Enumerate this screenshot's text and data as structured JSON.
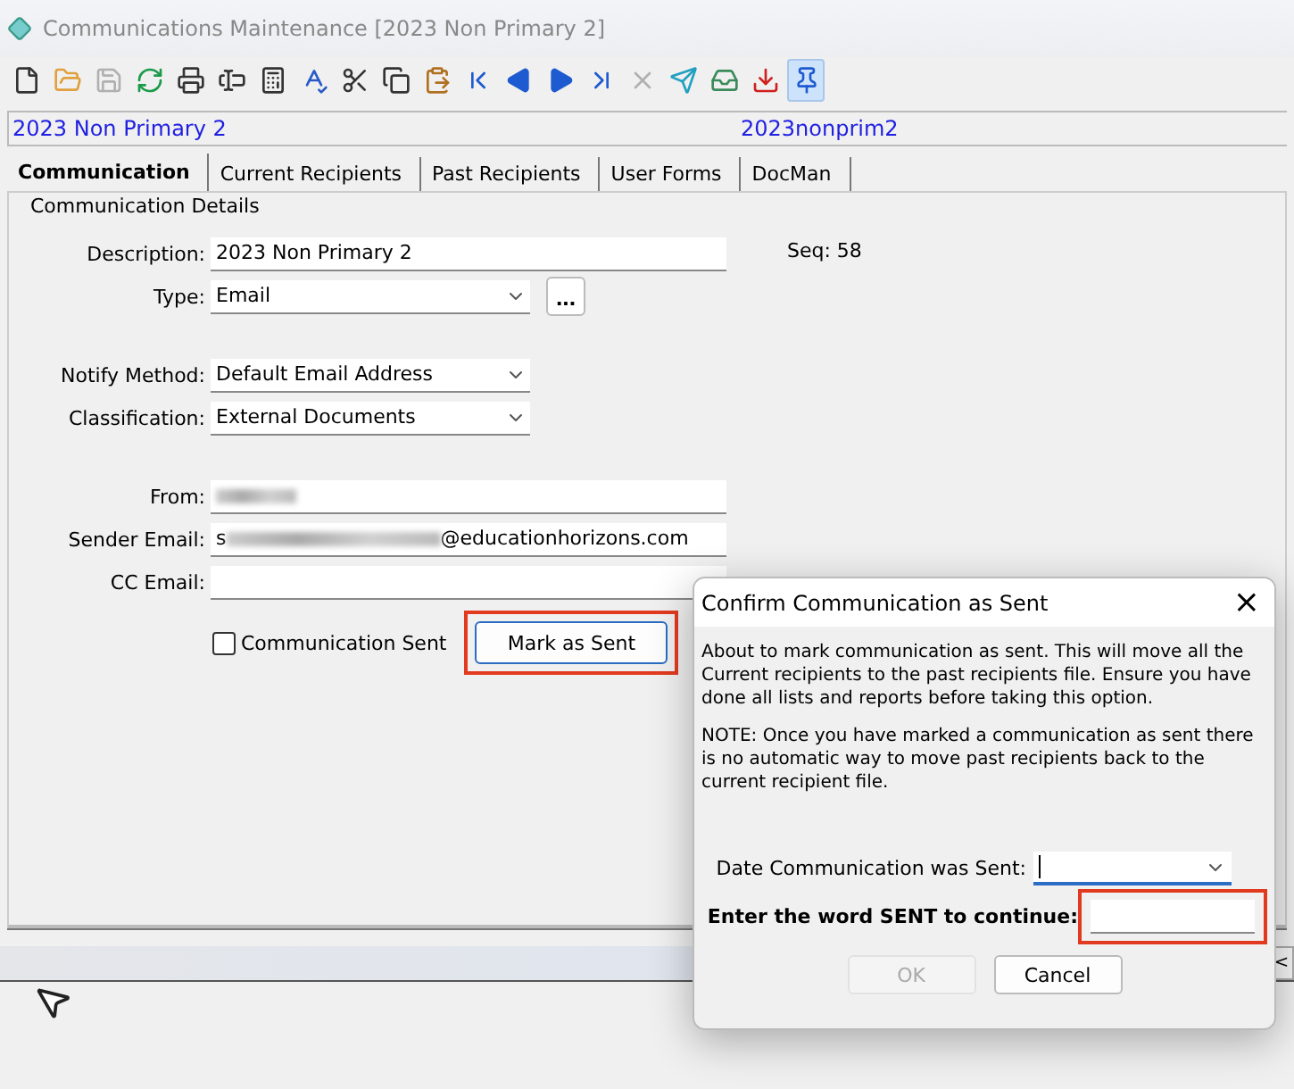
{
  "window": {
    "title": "Communications Maintenance  [2023 Non Primary 2]"
  },
  "toolbar": [
    {
      "disabled": false,
      "pressed": false
    },
    {
      "disabled": false,
      "pressed": false
    },
    {
      "disabled": true,
      "pressed": false
    },
    {
      "disabled": false,
      "pressed": false
    },
    {
      "disabled": false,
      "pressed": false
    },
    {
      "disabled": false,
      "pressed": false
    },
    {
      "disabled": false,
      "pressed": false
    },
    {
      "disabled": false,
      "pressed": false
    },
    {
      "disabled": false,
      "pressed": false
    },
    {
      "disabled": false,
      "pressed": false
    },
    {
      "disabled": false,
      "pressed": false
    },
    {
      "disabled": false,
      "pressed": false
    },
    {
      "disabled": false,
      "pressed": false
    },
    {
      "disabled": false,
      "pressed": false
    },
    {
      "disabled": false,
      "pressed": false
    },
    {
      "disabled": true,
      "pressed": false
    },
    {
      "disabled": false,
      "pressed": false
    },
    {
      "disabled": false,
      "pressed": false
    },
    {
      "disabled": false,
      "pressed": false
    },
    {
      "disabled": false,
      "pressed": true
    }
  ],
  "header": {
    "name": "2023 Non Primary 2",
    "code": "2023nonprim2"
  },
  "tabs": [
    {
      "label": "Communication",
      "selected": true
    },
    {
      "label": "Current Recipients",
      "selected": false
    },
    {
      "label": "Past Recipients",
      "selected": false
    },
    {
      "label": "User Forms",
      "selected": false
    },
    {
      "label": "DocMan",
      "selected": false
    }
  ],
  "group": {
    "title": "Communication Details",
    "seq": "Seq: 58"
  },
  "fields": [
    {
      "kind": "text",
      "label": "Description:",
      "value": "2023 Non Primary 2"
    },
    {
      "kind": "combo",
      "label": "Type:",
      "value": "Email",
      "button": "..."
    },
    {
      "kind": "gap"
    },
    {
      "kind": "combo",
      "label": "Notify Method:",
      "value": "Default Email Address"
    },
    {
      "kind": "combo",
      "label": "Classification:",
      "value": "External Documents"
    },
    {
      "kind": "gap"
    },
    {
      "kind": "blurred",
      "label": "From:"
    },
    {
      "kind": "blurred",
      "label": "Sender Email:",
      "prefix": "s",
      "suffix": "@educationhorizons.com"
    },
    {
      "kind": "text",
      "label": "CC Email:"
    }
  ],
  "sent_checkbox": {
    "label": "Communication Sent",
    "checked": false
  },
  "mark_button": {
    "label": "Mark as Sent",
    "highlighted": true
  },
  "side_button": {
    "label": "<"
  },
  "dialog": {
    "title": "Confirm Communication as Sent",
    "close": "×",
    "paragraphs": [
      "About to mark communication as sent.  This will move all the Current recipients to the past recipients file.  Ensure you have done all lists and reports before taking this option.",
      "NOTE:  Once you have marked a communication as sent there is no automatic way to move past recipients back to the current recipient file."
    ],
    "date_label": "Date Communication was Sent:",
    "word_label": "Enter the word SENT to continue:",
    "word_highlighted": true,
    "ok": {
      "label": "OK",
      "disabled": true
    },
    "cancel": {
      "label": "Cancel",
      "disabled": false
    }
  }
}
